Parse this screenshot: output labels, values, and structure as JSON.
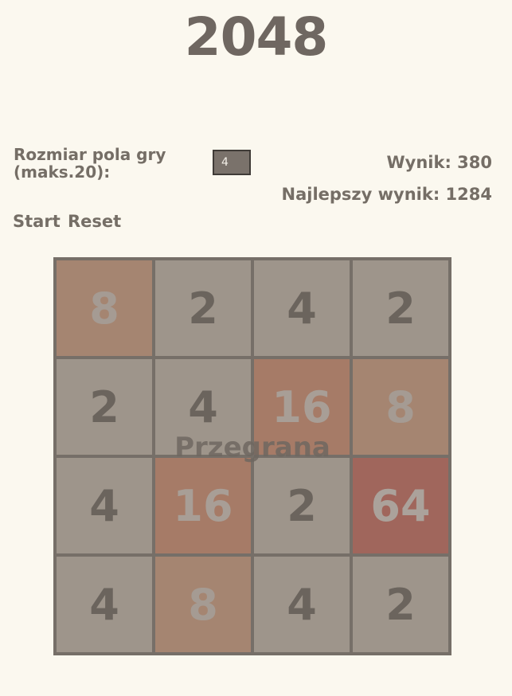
{
  "title": "2048",
  "size_control": {
    "label": "Rozmiar pola gry (maks.20):",
    "value": "4"
  },
  "score": {
    "text": "Wynik: 380",
    "value": 380
  },
  "best": {
    "text": "Najlepszy wynik: 1284",
    "value": 1284
  },
  "buttons": {
    "start": "Start",
    "reset": "Reset"
  },
  "board": {
    "size": 4,
    "tiles": [
      [
        "8",
        "2",
        "4",
        "2"
      ],
      [
        "2",
        "4",
        "16",
        "8"
      ],
      [
        "4",
        "16",
        "2",
        "64"
      ],
      [
        "4",
        "8",
        "4",
        "2"
      ]
    ]
  },
  "status": "Przegrana",
  "colors": {
    "background": "#fbf8ef",
    "board": "#766f68",
    "tile_2_4": "#9e958b",
    "tile_8": "#a58571",
    "tile_16": "#a67b67",
    "tile_64": "#a0665c"
  }
}
